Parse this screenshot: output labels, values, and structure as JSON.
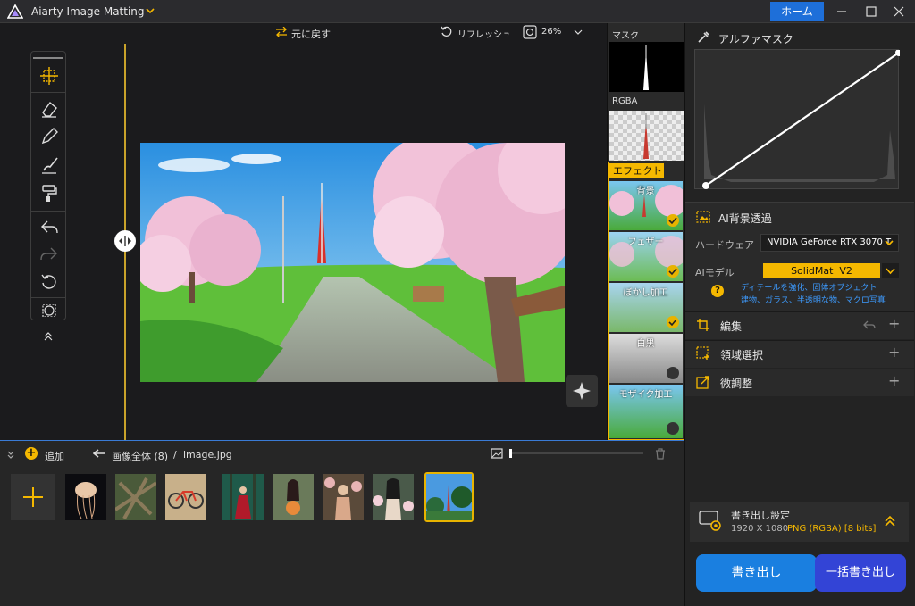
{
  "titlebar": {
    "app_title": "Aiarty Image Matting",
    "home_label": "ホーム"
  },
  "topbar": {
    "undo_label": "元に戻す",
    "refresh_label": "リフレッシュ",
    "zoom": "26%"
  },
  "thumbs": {
    "mask_label": "マスク",
    "rgba_label": "RGBA",
    "effect_label": "エフェクト",
    "effects": [
      {
        "label": "背景",
        "checked": true
      },
      {
        "label": "フェザー",
        "checked": true
      },
      {
        "label": "ぼかし加工",
        "checked": true
      },
      {
        "label": "白黒",
        "checked": false
      },
      {
        "label": "モザイク加工",
        "checked": false
      }
    ]
  },
  "right": {
    "alpha_mask_title": "アルファマスク",
    "ai_bg_title": "AI背景透過",
    "hardware_label": "ハードウェア",
    "hardware_value": "NVIDIA GeForce RTX 3070 T",
    "ai_model_label": "AIモデル",
    "ai_model_value": "SolidMat  V2",
    "model_desc_1": "ディテールを強化、固体オブジェクト",
    "model_desc_2": "建物、ガラス、半透明な物、マクロ写真",
    "edit_label": "編集",
    "region_label": "領域選択",
    "fine_label": "微調整"
  },
  "bottom": {
    "add_label": "追加",
    "breadcrumb_all": "画像全体 (8)",
    "breadcrumb_sep": "/",
    "breadcrumb_file": "image.jpg"
  },
  "export": {
    "title": "書き出し設定",
    "resolution": "1920 X 1080",
    "format": "PNG (RGBA) [8 bits]",
    "export_label": "書き出し",
    "batch_label": "一括書き出し"
  },
  "colors": {
    "accent": "#f5b800",
    "blue": "#1e6fd9",
    "batch": "#3344d6"
  }
}
